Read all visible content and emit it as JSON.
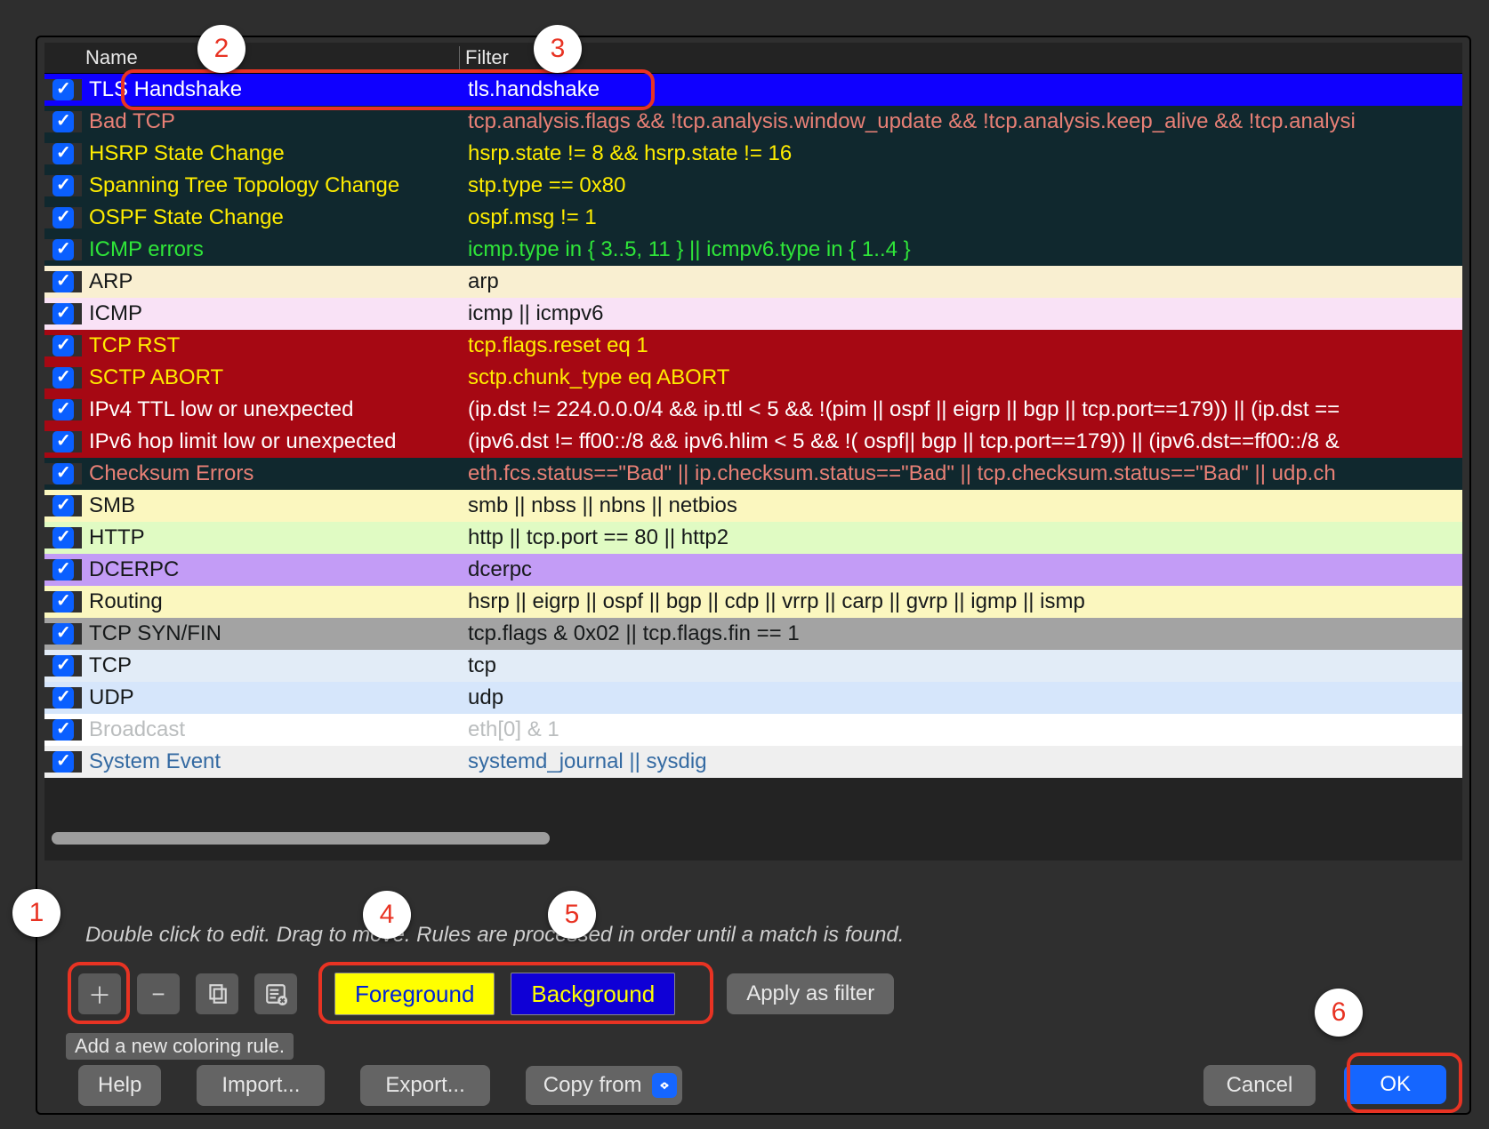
{
  "header": {
    "name_col": "Name",
    "filter_col": "Filter"
  },
  "rules": [
    {
      "name": "TLS Handshake",
      "filter": "tls.handshake",
      "fg": "#ffffff",
      "bg": "#0f00ff"
    },
    {
      "name": "Bad TCP",
      "filter": "tcp.analysis.flags && !tcp.analysis.window_update && !tcp.analysis.keep_alive && !tcp.analysi",
      "fg": "#e88076",
      "bg": "#10282e"
    },
    {
      "name": "HSRP State Change",
      "filter": "hsrp.state != 8 && hsrp.state != 16",
      "fg": "#ffed00",
      "bg": "#10282e"
    },
    {
      "name": "Spanning Tree Topology  Change",
      "filter": "stp.type == 0x80",
      "fg": "#ffed00",
      "bg": "#10282e"
    },
    {
      "name": "OSPF State Change",
      "filter": "ospf.msg != 1",
      "fg": "#ffed00",
      "bg": "#10282e"
    },
    {
      "name": "ICMP errors",
      "filter": "icmp.type in { 3..5, 11 } || icmpv6.type in { 1..4 }",
      "fg": "#2fe639",
      "bg": "#10282e"
    },
    {
      "name": "ARP",
      "filter": "arp",
      "fg": "#16191a",
      "bg": "#f9efd1"
    },
    {
      "name": "ICMP",
      "filter": "icmp || icmpv6",
      "fg": "#16191a",
      "bg": "#f9e2f6"
    },
    {
      "name": "TCP RST",
      "filter": "tcp.flags.reset eq 1",
      "fg": "#ffed00",
      "bg": "#a60813"
    },
    {
      "name": "SCTP ABORT",
      "filter": "sctp.chunk_type eq ABORT",
      "fg": "#ffed00",
      "bg": "#a60813"
    },
    {
      "name": "IPv4 TTL low or unexpected",
      "filter": "(ip.dst != 224.0.0.0/4 && ip.ttl < 5 && !(pim || ospf || eigrp || bgp || tcp.port==179)) || (ip.dst ==",
      "fg": "#ffffff",
      "bg": "#a60813"
    },
    {
      "name": "IPv6 hop limit low or unexpected",
      "filter": "(ipv6.dst != ff00::/8 && ipv6.hlim < 5 && !( ospf|| bgp || tcp.port==179)) || (ipv6.dst==ff00::/8 &",
      "fg": "#ffffff",
      "bg": "#a60813"
    },
    {
      "name": "Checksum Errors",
      "filter": "eth.fcs.status==\"Bad\" || ip.checksum.status==\"Bad\" || tcp.checksum.status==\"Bad\" || udp.ch",
      "fg": "#e88076",
      "bg": "#10282e"
    },
    {
      "name": "SMB",
      "filter": "smb || nbss || nbns || netbios",
      "fg": "#16191a",
      "bg": "#fbf7bf"
    },
    {
      "name": "HTTP",
      "filter": "http || tcp.port == 80 || http2",
      "fg": "#16191a",
      "bg": "#e0fbc3"
    },
    {
      "name": "DCERPC",
      "filter": "dcerpc",
      "fg": "#16191a",
      "bg": "#c39cf6"
    },
    {
      "name": "Routing",
      "filter": "hsrp || eigrp || ospf || bgp || cdp || vrrp || carp || gvrp || igmp || ismp",
      "fg": "#16191a",
      "bg": "#fbf7bf"
    },
    {
      "name": "TCP SYN/FIN",
      "filter": "tcp.flags & 0x02 || tcp.flags.fin == 1",
      "fg": "#16191a",
      "bg": "#a3a3a3"
    },
    {
      "name": "TCP",
      "filter": "tcp",
      "fg": "#16191a",
      "bg": "#e2ecf7"
    },
    {
      "name": "UDP",
      "filter": "udp",
      "fg": "#16191a",
      "bg": "#d6e6fb"
    },
    {
      "name": "Broadcast",
      "filter": "eth[0] & 1",
      "fg": "#babdbe",
      "bg": "#ffffff"
    },
    {
      "name": "System Event",
      "filter": "systemd_journal || sysdig",
      "fg": "#346aa2",
      "bg": "#efefef"
    }
  ],
  "hint_text": "Double click to edit. Drag to move. Rules are processed in order until a match is found.",
  "buttons": {
    "foreground": "Foreground",
    "background": "Background",
    "apply_as_filter": "Apply as filter",
    "help": "Help",
    "import": "Import...",
    "export": "Export...",
    "copy_from": "Copy from",
    "cancel": "Cancel",
    "ok": "OK"
  },
  "tooltip": "Add a new coloring rule.",
  "callouts": {
    "c1": "1",
    "c2": "2",
    "c3": "3",
    "c4": "4",
    "c5": "5",
    "c6": "6"
  }
}
